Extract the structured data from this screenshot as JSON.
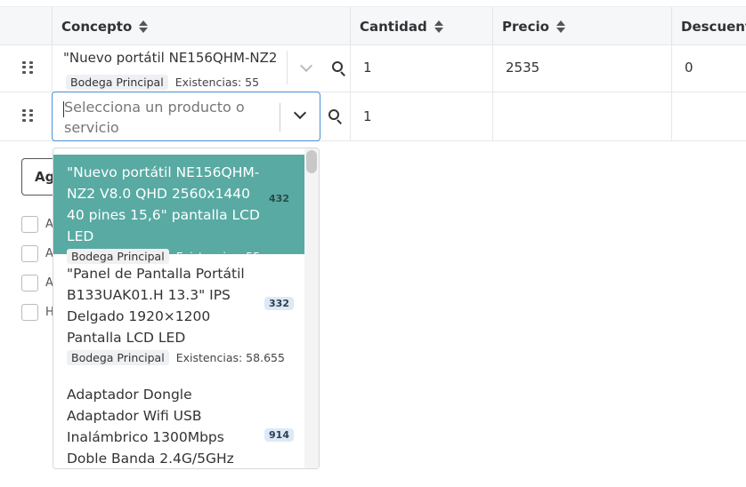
{
  "table": {
    "headers": {
      "concepto": "Concepto",
      "cantidad": "Cantidad",
      "precio": "Precio",
      "descuento": "Descuent"
    },
    "row1": {
      "concepto": "\"Nuevo portátil NE156QHM-NZ2",
      "warehouse": "Bodega Principal",
      "stock": "Existencias: 55",
      "cantidad": "1",
      "precio": "2535",
      "descuento": "0"
    },
    "row2": {
      "placeholder": "Selecciona un producto o servicio",
      "cantidad": "1"
    }
  },
  "dropdown": {
    "options": [
      {
        "title": "\"Nuevo portátil NE156QHM-NZ2 V8.0 QHD 2560x1440 40 pines 15,6\" pantalla LCD LED",
        "count": "432",
        "warehouse": "Bodega Principal",
        "stock": "Existencias: 55"
      },
      {
        "title": "\"Panel de Pantalla Portátil B133UAK01.H 13.3\" IPS Delgado 1920×1200 Pantalla LCD LED",
        "count": "332",
        "warehouse": "Bodega Principal",
        "stock": "Existencias: 58.655"
      },
      {
        "title": "Adaptador Dongle Adaptador Wifi USB Inalámbrico 1300Mbps Doble Banda 2.4G/5GHz",
        "count": "914"
      }
    ]
  },
  "below": {
    "button_partial": "Ag",
    "checkbox_labels": [
      "A",
      "A",
      "A",
      "H"
    ]
  },
  "colors": {
    "active_option": "#58aaa3",
    "focus_border": "#4a90d9"
  }
}
